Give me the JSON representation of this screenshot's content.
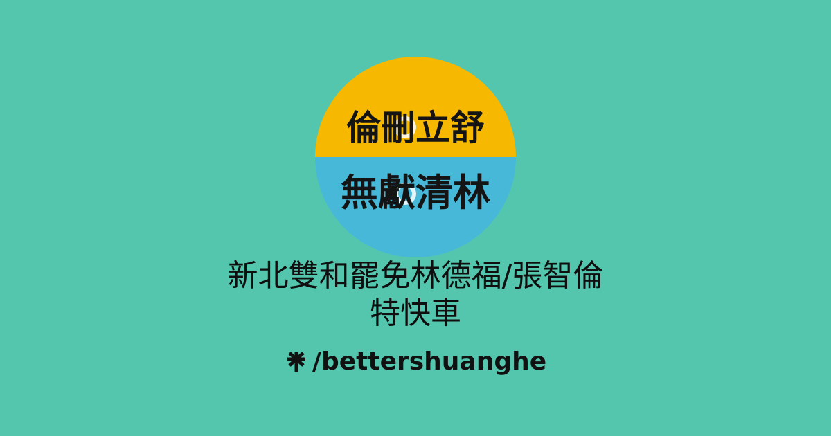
{
  "avatar": {
    "top_text": "倫刪立舒",
    "bottom_text": "無獻清林",
    "top_color": "#f6b800",
    "bottom_color": "#48b8d8"
  },
  "profile": {
    "title_line1": "新北雙和罷免林德福/張智倫",
    "title_line2": "特快車",
    "handle": "/bettershuanghe",
    "brand_icon": "linktree-icon"
  },
  "colors": {
    "background": "#54c6ae",
    "text": "#111111"
  }
}
